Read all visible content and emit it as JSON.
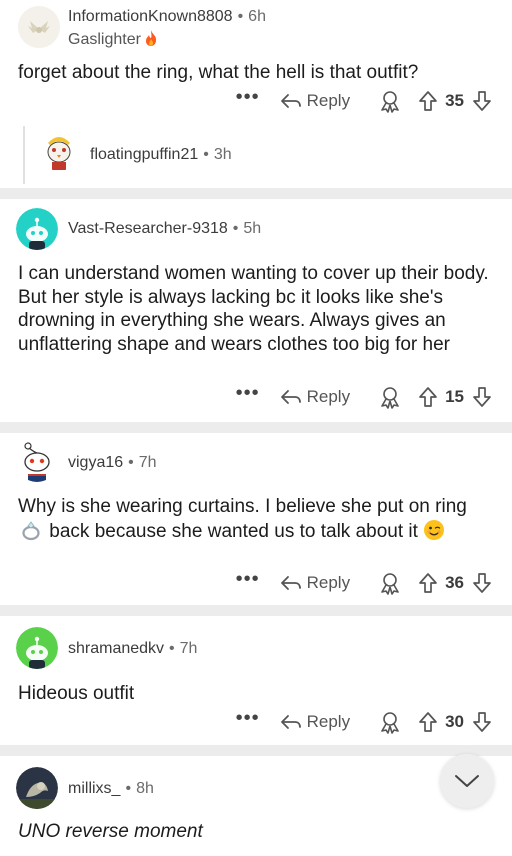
{
  "comments": [
    {
      "username": "InformationKnown8808",
      "time": "6h",
      "flair": "Gaslighter",
      "body": "forget about the ring, what the hell is that outfit?",
      "reply_label": "Reply",
      "score": "35",
      "avatar_icon": "winged-snoo-avatar",
      "reply_preview": {
        "username": "floatingpuffin21",
        "time": "3h",
        "avatar_icon": "puffin-avatar"
      }
    },
    {
      "username": "Vast-Researcher-9318",
      "time": "5h",
      "body": "I can understand women wanting to cover up their body. But her style is always lacking bc it looks like she's drowning in everything she wears. Always gives an unflattering shape and wears clothes too big for her",
      "reply_label": "Reply",
      "score": "15",
      "avatar_icon": "teal-snoo-avatar"
    },
    {
      "username": "vigya16",
      "time": "7h",
      "body_part1": "Why is she wearing curtains. I believe she put on ring",
      "body_part2": "back because she wanted us to talk about it",
      "reply_label": "Reply",
      "score": "36",
      "avatar_icon": "snoo-avatar"
    },
    {
      "username": "shramanedkv",
      "time": "7h",
      "body": "Hideous outfit",
      "reply_label": "Reply",
      "score": "30",
      "avatar_icon": "green-snoo-avatar"
    },
    {
      "username": "millixs_",
      "time": "8h",
      "body": "UNO reverse moment",
      "avatar_icon": "photo-avatar"
    }
  ],
  "colors": {
    "separator": "#ececec",
    "teal": "#24d1c6",
    "green": "#5ad14a",
    "fire": "#ff4500"
  }
}
